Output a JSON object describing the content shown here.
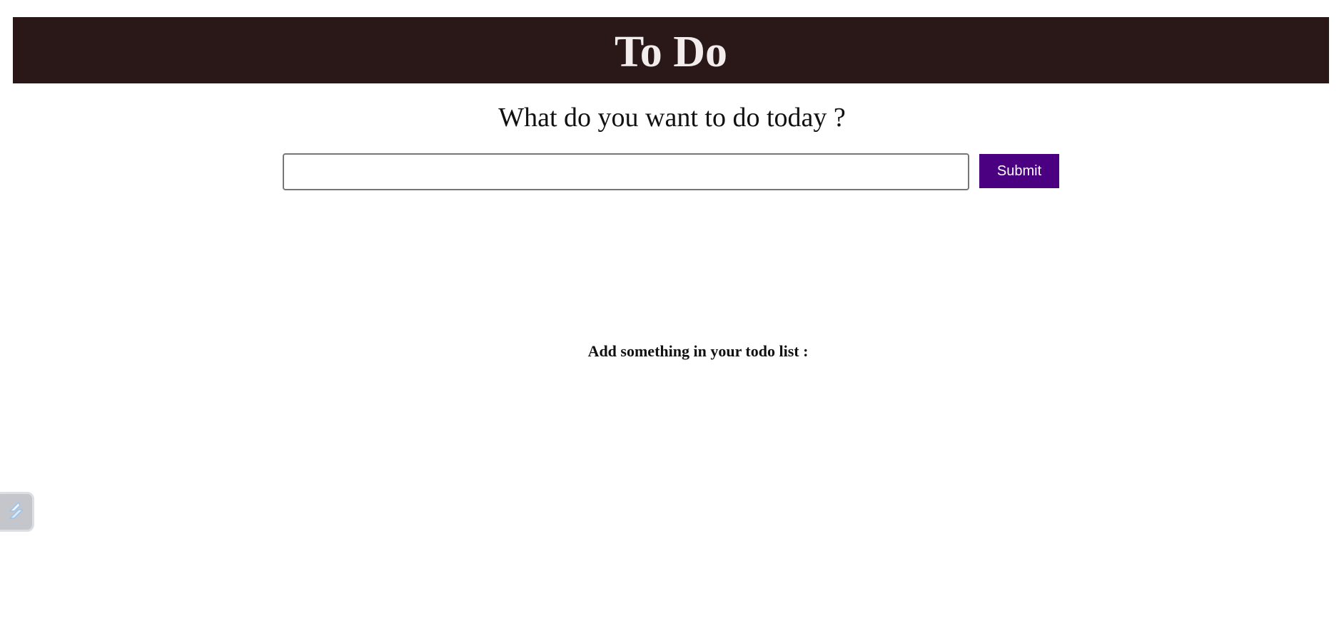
{
  "header": {
    "title": "To Do"
  },
  "main": {
    "prompt": "What do you want to do today ?",
    "input": {
      "value": "",
      "placeholder": ""
    },
    "submit_label": "Submit",
    "empty_message": "Add something in your todo list :"
  },
  "widget": {
    "icon": "extension-tool-icon"
  },
  "colors": {
    "header_bg": "#2a1718",
    "header_text": "#f3ecec",
    "submit_bg": "#4b0082",
    "submit_text": "#ffffff"
  }
}
